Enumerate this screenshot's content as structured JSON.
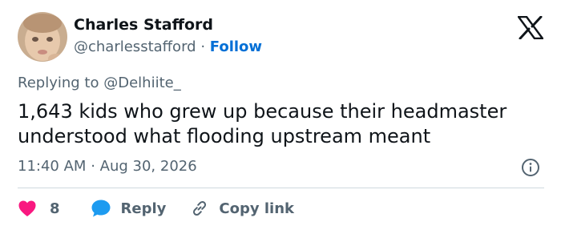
{
  "author": {
    "name": "Charles Stafford",
    "handle": "@charlesstafford",
    "separator": "·",
    "follow_label": "Follow"
  },
  "reply_context": {
    "prefix": "Replying to",
    "mention": "@Delhiite_"
  },
  "tweet": {
    "text": "1,643 kids who grew up because their headmaster understood what flooding upstream meant",
    "time": "11:40 AM",
    "separator": "·",
    "date": "Aug 30, 2026"
  },
  "actions": {
    "like_count": "8",
    "reply_label": "Reply",
    "copy_link_label": "Copy link"
  },
  "icons": {
    "logo": "x-logo-icon",
    "info": "info-icon",
    "like": "heart-icon",
    "reply": "speech-bubble-icon",
    "copy_link": "link-icon"
  },
  "colors": {
    "accent": "#006fd6",
    "text": "#0f1419",
    "muted": "#536471",
    "like": "#f91880",
    "reply": "#1d9bf0",
    "divider": "#cfd9de"
  }
}
